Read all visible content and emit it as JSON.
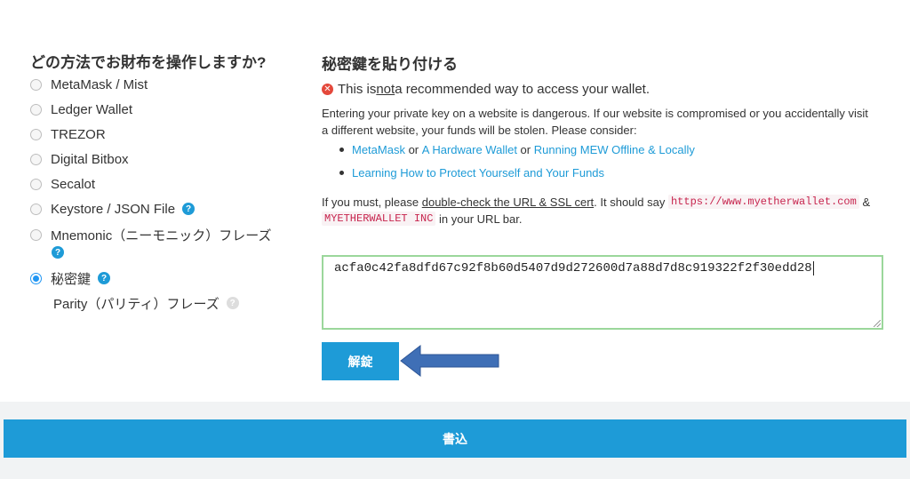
{
  "left": {
    "title": "どの方法でお財布を操作しますか?",
    "options": [
      {
        "label": "MetaMask / Mist",
        "checked": false
      },
      {
        "label": "Ledger Wallet",
        "checked": false
      },
      {
        "label": "TREZOR",
        "checked": false
      },
      {
        "label": "Digital Bitbox",
        "checked": false
      },
      {
        "label": "Secalot",
        "checked": false
      },
      {
        "label": "Keystore / JSON File",
        "checked": false
      },
      {
        "label": "Mnemonic（ニーモニック）フレーズ",
        "checked": false
      },
      {
        "label": "秘密鍵",
        "checked": true
      },
      {
        "label": "Parity（パリティ）フレーズ",
        "checked": false
      }
    ],
    "help_glyph": "?"
  },
  "right": {
    "title": "秘密鍵を貼り付ける",
    "warning": {
      "pre": "This is ",
      "emph": "not",
      "post": " a recommended way to access your wallet."
    },
    "paragraph": "Entering your private key on a website is dangerous. If our website is compromised or you accidentally visit a different website, your funds will be stolen. Please consider:",
    "bullets": {
      "b1_link1": "MetaMask",
      "b1_or1": " or ",
      "b1_link2": "A Hardware Wallet",
      "b1_or2": " or ",
      "b1_link3": "Running MEW Offline & Locally",
      "b2_link": "Learning How to Protect Yourself and Your Funds"
    },
    "must": {
      "pre": "If you must, please ",
      "underlined": "double-check the URL & SSL cert",
      "mid": ". It should say ",
      "url": "https://www.myetherwallet.com",
      "amp": " &",
      "company": "MYETHERWALLET INC",
      "post": " in your URL bar."
    },
    "private_key_value": "acfa0c42fa8dfd67c92f8b60d5407d9d272600d7a88d7d8c919322f2f30edd28",
    "unlock_label": "解錠"
  },
  "footer": {
    "submit_label": "書込"
  },
  "colors": {
    "accent": "#1e9bd7",
    "arrow": "#3f6fb6",
    "error": "#e4483b",
    "valid_border": "#9bd79b"
  }
}
